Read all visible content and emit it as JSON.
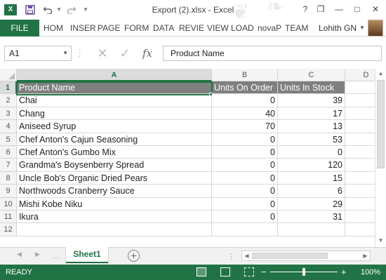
{
  "window": {
    "title": "Export (2).xlsx - Excel",
    "app_icon_label": "X",
    "controls": {
      "help": "?",
      "restore": "❐",
      "minimize": "—",
      "maximize": "□",
      "close": "✕"
    }
  },
  "ribbon": {
    "file_tab": "FILE",
    "tabs": [
      "HOM",
      "INSER",
      "PAGE",
      "FORM",
      "DATA",
      "REVIE",
      "VIEW",
      "LOAD",
      "novaP",
      "TEAM"
    ],
    "user_name": "Lohith GN"
  },
  "formula_bar": {
    "name_box": "A1",
    "formula": "Product Name",
    "fx_label": "fx"
  },
  "columns": [
    "A",
    "B",
    "C",
    "D"
  ],
  "rows": [
    "1",
    "2",
    "3",
    "4",
    "5",
    "6",
    "7",
    "8",
    "9",
    "10",
    "11",
    "12"
  ],
  "sheet": {
    "header": [
      "Product Name",
      "Units On Order",
      "Units In Stock"
    ],
    "data": [
      [
        "Chai",
        "0",
        "39"
      ],
      [
        "Chang",
        "40",
        "17"
      ],
      [
        "Aniseed Syrup",
        "70",
        "13"
      ],
      [
        "Chef Anton's Cajun Seasoning",
        "0",
        "53"
      ],
      [
        "Chef Anton's Gumbo Mix",
        "0",
        "0"
      ],
      [
        "Grandma's Boysenberry Spread",
        "0",
        "120"
      ],
      [
        "Uncle Bob's Organic Dried Pears",
        "0",
        "15"
      ],
      [
        "Northwoods Cranberry Sauce",
        "0",
        "6"
      ],
      [
        "Mishi Kobe Niku",
        "0",
        "29"
      ],
      [
        "Ikura",
        "0",
        "31"
      ]
    ]
  },
  "tabs_bar": {
    "active_sheet": "Sheet1",
    "add_sheet_label": "+",
    "dots": "..."
  },
  "status_bar": {
    "status": "READY",
    "zoom": "100%",
    "zoom_minus": "−",
    "zoom_plus": "+"
  },
  "colors": {
    "accent": "#217346",
    "header_fill": "#7f7f7f"
  }
}
